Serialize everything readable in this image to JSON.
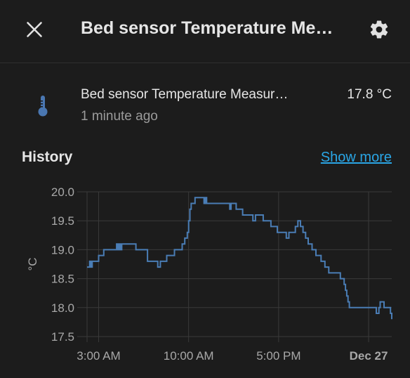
{
  "dialog": {
    "title": "Bed sensor Temperature Me…"
  },
  "entity": {
    "name": "Bed sensor Temperature Measur…",
    "last_changed": "1 minute ago",
    "state": "17.8 °C",
    "icon": "thermometer-icon",
    "icon_color": "#4a77b1"
  },
  "history": {
    "title": "History",
    "show_more_label": "Show more",
    "link_color": "#2aa6e6"
  },
  "chart_data": {
    "type": "line",
    "step": true,
    "ylabel": "°C",
    "ylim": [
      17.5,
      20.0
    ],
    "y_ticks": [
      "20.0",
      "19.5",
      "19.0",
      "18.5",
      "18.0",
      "17.5"
    ],
    "x_ticks": [
      "3:00 AM",
      "10:00 AM",
      "5:00 PM",
      "Dec 27"
    ],
    "x_tick_hours": [
      3,
      10,
      17,
      24
    ],
    "xlim_hours": [
      2.1,
      25.8
    ],
    "grid": true,
    "series": [
      {
        "color": "#4a7db5",
        "points": [
          [
            2.1,
            18.7
          ],
          [
            2.3,
            18.8
          ],
          [
            2.4,
            18.7
          ],
          [
            2.5,
            18.8
          ],
          [
            2.9,
            18.8
          ],
          [
            3.0,
            18.9
          ],
          [
            3.4,
            19.0
          ],
          [
            4.4,
            19.1
          ],
          [
            4.5,
            19.0
          ],
          [
            4.6,
            19.1
          ],
          [
            4.7,
            19.0
          ],
          [
            4.8,
            19.1
          ],
          [
            5.3,
            19.1
          ],
          [
            5.9,
            19.0
          ],
          [
            6.8,
            18.8
          ],
          [
            7.6,
            18.7
          ],
          [
            7.8,
            18.8
          ],
          [
            8.3,
            18.9
          ],
          [
            8.9,
            19.0
          ],
          [
            9.5,
            19.1
          ],
          [
            9.7,
            19.2
          ],
          [
            9.9,
            19.3
          ],
          [
            10.0,
            19.5
          ],
          [
            10.1,
            19.7
          ],
          [
            10.2,
            19.8
          ],
          [
            10.5,
            19.9
          ],
          [
            11.2,
            19.8
          ],
          [
            11.3,
            19.9
          ],
          [
            11.4,
            19.8
          ],
          [
            12.0,
            19.8
          ],
          [
            13.1,
            19.8
          ],
          [
            13.2,
            19.7
          ],
          [
            13.3,
            19.8
          ],
          [
            13.7,
            19.7
          ],
          [
            14.2,
            19.6
          ],
          [
            15.0,
            19.5
          ],
          [
            15.2,
            19.6
          ],
          [
            15.8,
            19.5
          ],
          [
            16.4,
            19.4
          ],
          [
            16.9,
            19.3
          ],
          [
            17.6,
            19.2
          ],
          [
            17.8,
            19.3
          ],
          [
            18.3,
            19.4
          ],
          [
            18.5,
            19.5
          ],
          [
            18.7,
            19.4
          ],
          [
            18.9,
            19.3
          ],
          [
            19.1,
            19.2
          ],
          [
            19.3,
            19.1
          ],
          [
            19.6,
            19.0
          ],
          [
            19.9,
            18.9
          ],
          [
            20.3,
            18.8
          ],
          [
            20.6,
            18.7
          ],
          [
            20.9,
            18.6
          ],
          [
            21.8,
            18.5
          ],
          [
            22.1,
            18.4
          ],
          [
            22.2,
            18.3
          ],
          [
            22.3,
            18.2
          ],
          [
            22.4,
            18.1
          ],
          [
            22.5,
            18.0
          ],
          [
            24.6,
            17.9
          ],
          [
            24.8,
            18.0
          ],
          [
            24.9,
            18.1
          ],
          [
            25.2,
            18.0
          ],
          [
            25.7,
            17.9
          ],
          [
            25.8,
            17.8
          ]
        ]
      }
    ]
  }
}
